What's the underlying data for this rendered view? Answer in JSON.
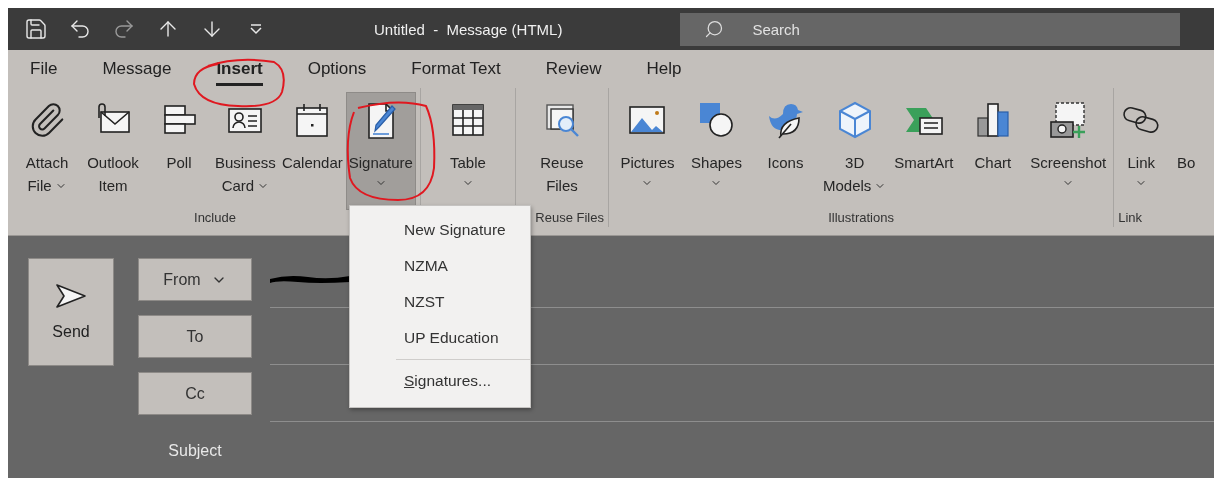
{
  "title_bar": {
    "title": "Untitled  -  Message (HTML)",
    "search": {
      "placeholder": "Search"
    }
  },
  "ribbon_tabs": [
    {
      "label": "File",
      "selected": false
    },
    {
      "label": "Message",
      "selected": false
    },
    {
      "label": "Insert",
      "selected": true
    },
    {
      "label": "Options",
      "selected": false
    },
    {
      "label": "Format Text",
      "selected": false
    },
    {
      "label": "Review",
      "selected": false
    },
    {
      "label": "Help",
      "selected": false
    }
  ],
  "ribbon_groups": [
    {
      "label": "Include",
      "buttons": [
        {
          "lines": [
            "Attach",
            "File"
          ],
          "kind": "menu_inline",
          "selected": false
        },
        {
          "lines": [
            "Outlook",
            "Item"
          ],
          "kind": "plain",
          "selected": false
        },
        {
          "lines": [
            "Poll"
          ],
          "kind": "plain",
          "selected": false
        },
        {
          "lines": [
            "Business",
            "Card"
          ],
          "kind": "menu_inline",
          "selected": false
        },
        {
          "lines": [
            "Calendar"
          ],
          "kind": "plain",
          "selected": false
        },
        {
          "lines": [
            "Signature"
          ],
          "kind": "menu_below",
          "selected": true
        }
      ]
    },
    {
      "buttons": [
        {
          "lines": [
            "Table"
          ],
          "kind": "menu_below",
          "selected": false
        }
      ]
    },
    {
      "label": "Reuse Files",
      "buttons": [
        {
          "lines": [
            "Reuse",
            "Files"
          ],
          "kind": "plain",
          "selected": false
        }
      ]
    },
    {
      "label": "Illustrations",
      "buttons": [
        {
          "lines": [
            "Pictures"
          ],
          "kind": "menu_below",
          "selected": false
        },
        {
          "lines": [
            "Shapes"
          ],
          "kind": "menu_below",
          "selected": false
        },
        {
          "lines": [
            "Icons"
          ],
          "kind": "plain",
          "selected": false
        },
        {
          "lines": [
            "3D",
            "Models"
          ],
          "kind": "menu_inline",
          "selected": false
        },
        {
          "lines": [
            "SmartArt"
          ],
          "kind": "plain",
          "selected": false
        },
        {
          "lines": [
            "Chart"
          ],
          "kind": "plain",
          "selected": false
        },
        {
          "lines": [
            "Screenshot"
          ],
          "kind": "menu_below",
          "selected": false
        }
      ]
    },
    {
      "label": "Link",
      "buttons": [
        {
          "lines": [
            "Link"
          ],
          "kind": "menu_below",
          "selected": false
        },
        {
          "lines": [
            "Bo"
          ],
          "kind": "plain",
          "selected": false
        }
      ]
    }
  ],
  "signature_menu": {
    "items": [
      {
        "label": "New Signature",
        "kind": "signature"
      },
      {
        "label": "NZMA",
        "kind": "signature"
      },
      {
        "label": "NZST",
        "kind": "signature"
      },
      {
        "label": "UP Education",
        "kind": "signature"
      },
      {
        "label": "Signatures...",
        "kind": "command"
      }
    ]
  },
  "compose": {
    "send": "Send",
    "from": "From",
    "to": "To",
    "cc": "Cc",
    "subject": "Subject"
  }
}
